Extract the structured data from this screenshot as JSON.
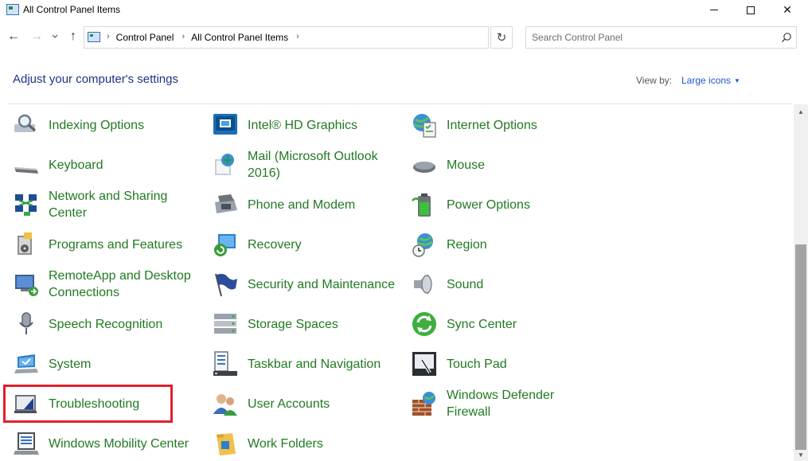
{
  "window": {
    "title": "All Control Panel Items",
    "minimize_label": "",
    "maximize_label": "",
    "close_label": "✕"
  },
  "nav": {
    "back": "←",
    "forward": "→",
    "recent": "⌄",
    "up": "↑",
    "breadcrumbs": [
      "Control Panel",
      "All Control Panel Items"
    ],
    "refresh": "↻",
    "search_placeholder": "Search Control Panel"
  },
  "header": {
    "title": "Adjust your computer's settings",
    "view_by_label": "View by:",
    "view_by_value": "Large icons"
  },
  "items": [
    {
      "label": "Indexing Options",
      "icon": "magnifier-icon"
    },
    {
      "label": "Intel® HD Graphics",
      "icon": "intel-graphics-icon"
    },
    {
      "label": "Internet Options",
      "icon": "globe-document-icon"
    },
    {
      "label": "Keyboard",
      "icon": "keyboard-icon"
    },
    {
      "label": "Mail (Microsoft Outlook 2016)",
      "icon": "mail-icon"
    },
    {
      "label": "Mouse",
      "icon": "mouse-icon"
    },
    {
      "label": "Network and Sharing Center",
      "icon": "network-icon"
    },
    {
      "label": "Phone and Modem",
      "icon": "phone-icon"
    },
    {
      "label": "Power Options",
      "icon": "battery-icon"
    },
    {
      "label": "Programs and Features",
      "icon": "programs-icon"
    },
    {
      "label": "Recovery",
      "icon": "recovery-icon"
    },
    {
      "label": "Region",
      "icon": "region-globe-icon"
    },
    {
      "label": "RemoteApp and Desktop Connections",
      "icon": "remote-desktop-icon"
    },
    {
      "label": "Security and Maintenance",
      "icon": "flag-icon"
    },
    {
      "label": "Sound",
      "icon": "speaker-icon"
    },
    {
      "label": "Speech Recognition",
      "icon": "microphone-icon"
    },
    {
      "label": "Storage Spaces",
      "icon": "storage-icon"
    },
    {
      "label": "Sync Center",
      "icon": "sync-icon"
    },
    {
      "label": "System",
      "icon": "computer-icon"
    },
    {
      "label": "Taskbar and Navigation",
      "icon": "taskbar-icon"
    },
    {
      "label": "Touch Pad",
      "icon": "touchpad-icon"
    },
    {
      "label": "Troubleshooting",
      "icon": "troubleshooting-icon"
    },
    {
      "label": "User Accounts",
      "icon": "users-icon"
    },
    {
      "label": "Windows Defender Firewall",
      "icon": "firewall-icon"
    },
    {
      "label": "Windows Mobility Center",
      "icon": "mobility-icon"
    },
    {
      "label": "Work Folders",
      "icon": "folder-icon"
    }
  ],
  "colors": {
    "link_green": "#217a21",
    "heading_blue": "#1e3287",
    "accent_blue": "#1e58c8",
    "highlight_red": "#e0202a"
  }
}
